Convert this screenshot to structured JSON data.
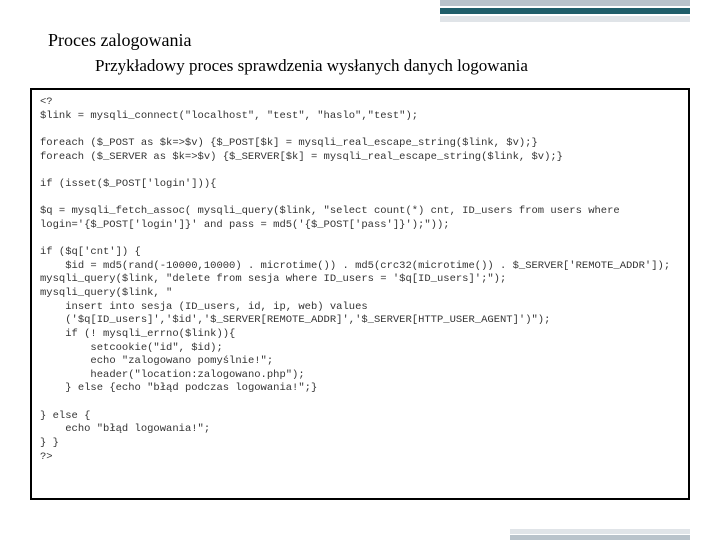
{
  "title": "Proces zalogowania",
  "subtitle": "Przykładowy proces sprawdzenia wysłanych danych logowania",
  "code": "<?\n$link = mysqli_connect(\"localhost\", \"test\", \"haslo\",\"test\");\n\nforeach ($_POST as $k=>$v) {$_POST[$k] = mysqli_real_escape_string($link, $v);}\nforeach ($_SERVER as $k=>$v) {$_SERVER[$k] = mysqli_real_escape_string($link, $v);}\n\nif (isset($_POST['login'])){\n\n$q = mysqli_fetch_assoc( mysqli_query($link, \"select count(*) cnt, ID_users from users where login='{$_POST['login']}' and pass = md5('{$_POST['pass']}');\"));\n\nif ($q['cnt']) {\n    $id = md5(rand(-10000,10000) . microtime()) . md5(crc32(microtime()) . $_SERVER['REMOTE_ADDR']);\nmysqli_query($link, \"delete from sesja where ID_users = '$q[ID_users]';\");\nmysqli_query($link, \"\n    insert into sesja (ID_users, id, ip, web) values\n    ('$q[ID_users]','$id','$_SERVER[REMOTE_ADDR]','$_SERVER[HTTP_USER_AGENT]')\");\n    if (! mysqli_errno($link)){\n        setcookie(\"id\", $id);\n        echo \"zalogowano pomyślnie!\";\n        header(\"location:zalogowano.php\");\n    } else {echo \"błąd podczas logowania!\";}\n\n} else {\n    echo \"błąd logowania!\";\n} }\n?>"
}
